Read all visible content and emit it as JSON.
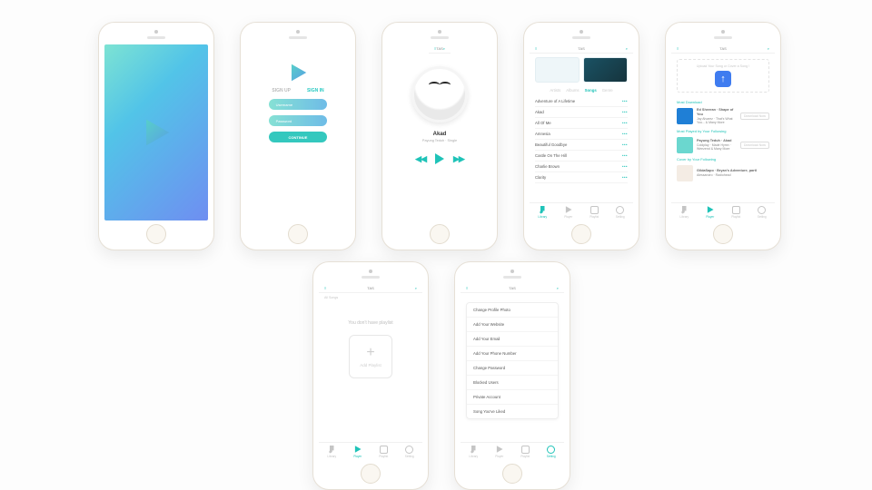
{
  "topbar": {
    "left": "≡",
    "title": "TAS",
    "right": "⌕"
  },
  "auth": {
    "tab_signup": "SIGN UP",
    "tab_signin": "SIGN IN",
    "username_ph": "Username",
    "password_ph": "Password",
    "continue": "CONTINUE"
  },
  "player": {
    "track": "Akad",
    "subtitle": "Payung Teduh · Single"
  },
  "songs": {
    "seg_artist": "Artists",
    "seg_albums": "Albums",
    "seg_songs": "Songs",
    "seg_genre": "Genre",
    "items": [
      "Adventure of A Lifetime",
      "Akad",
      "All Of Me",
      "Amnesia",
      "Beautiful Goodbye",
      "Castle On The Hill",
      "Charlie Brown",
      "Clarity"
    ]
  },
  "upload": {
    "banner": "Upload Your Song or Cover a Song !",
    "arrow": "↑",
    "sect_most_dl": "Most Download",
    "sect_most_played": "Most Played by Your Following",
    "sect_cover": "Cover by Your Following",
    "dl": {
      "t": "Ed Sheeran · Shape of You",
      "s": "Jay Alvarez · That's What You...\n& Many More",
      "b": "Download Now"
    },
    "mp": {
      "t": "Payung Teduh · Akad",
      "s": "Coldplay · Made Hymn · Weezend\n& Many More",
      "b": "Download Now"
    },
    "cv": {
      "t": "GildaSapo · Bryan's Adventure, partI",
      "s": "Alessandro · Radiohead"
    }
  },
  "playlist": {
    "label": "All Songs",
    "empty": "You don't have playlist",
    "add": "Add Playlist"
  },
  "settings": {
    "items": [
      "Change Profile Photo",
      "Add Your Website",
      "Add Your Email",
      "Add Your Phone Number",
      "Change Password",
      "Blocked Users",
      "Private Account",
      "Song You've Liked"
    ]
  },
  "tabs": {
    "lib": "Library",
    "player": "Player",
    "playlist": "Playlist",
    "setting": "Setting"
  }
}
